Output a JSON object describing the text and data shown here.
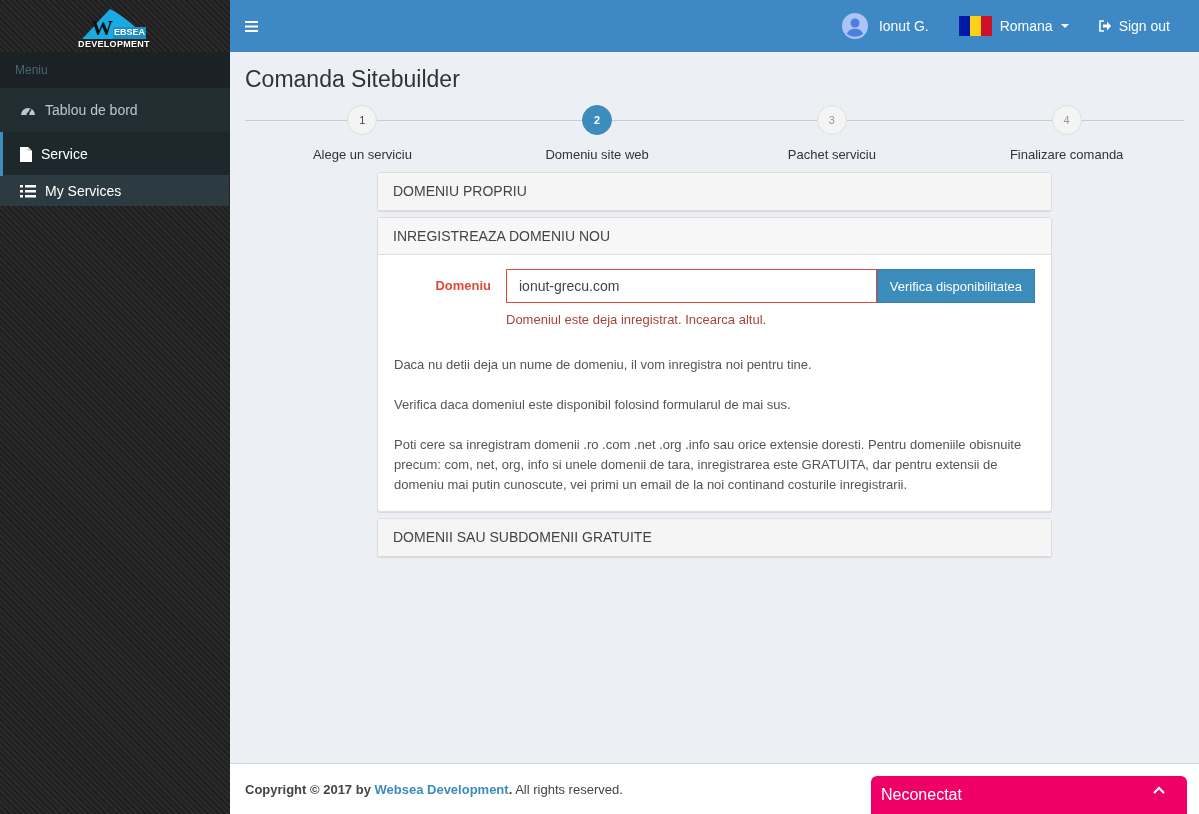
{
  "logo": {
    "letter": "W",
    "word": "EBSEA",
    "subtitle": "DEVELOPMENT"
  },
  "sidebar": {
    "header": "Meniu",
    "items": [
      {
        "label": "Tablou de bord",
        "kind": "dashboard",
        "selected": false
      },
      {
        "label": "Service",
        "kind": "file",
        "selected": true,
        "expanded": true,
        "children": [
          {
            "label": "My Services",
            "kind": "list",
            "selected": false
          }
        ]
      }
    ]
  },
  "topbar": {
    "user": "Ionut G.",
    "language": "Romana",
    "signout": "Sign out"
  },
  "page_title": "Comanda Sitebuilder",
  "steps": [
    {
      "number": "1",
      "label": "Alege un serviciu",
      "selected": false,
      "completed": true
    },
    {
      "number": "2",
      "label": "Domeniu site web",
      "selected": true,
      "completed": false
    },
    {
      "number": "3",
      "label": "Pachet serviciu",
      "selected": false,
      "completed": false
    },
    {
      "number": "4",
      "label": "Finalizare comanda",
      "selected": false,
      "completed": false
    }
  ],
  "panels": [
    {
      "title": "DOMENIU PROPRIU",
      "expanded": false
    },
    {
      "title": "INREGISTREAZA DOMENIU NOU",
      "expanded": true,
      "form": {
        "label": "Domeniu",
        "value": "ionut-grecu.com",
        "button": "Verifica disponibilitatea",
        "error": "Domeniul este deja inregistrat. Incearca altul."
      },
      "paragraphs": [
        "Daca nu detii deja un nume de domeniu, il vom inregistra noi pentru tine.",
        "Verifica daca domeniul este disponibil folosind formularul de mai sus.",
        "Poti cere sa inregistram domenii .ro .com .net .org .info sau orice extensie doresti. Pentru domeniile obisnuite precum: com, net, org, info si unele domenii de tara, inregistrarea este GRATUITA, dar pentru extensii de domeniu mai putin cunoscute, vei primi un email de la noi continand costurile inregistrarii."
      ]
    },
    {
      "title": "DOMENII SAU SUBDOMENII GRATUITE",
      "expanded": false
    }
  ],
  "footer": {
    "prefix": "Copyright © 2017 by ",
    "link": "Websea Development",
    "suffix": "**.** All rights reserved."
  },
  "chat": {
    "status": "Neconectat"
  }
}
